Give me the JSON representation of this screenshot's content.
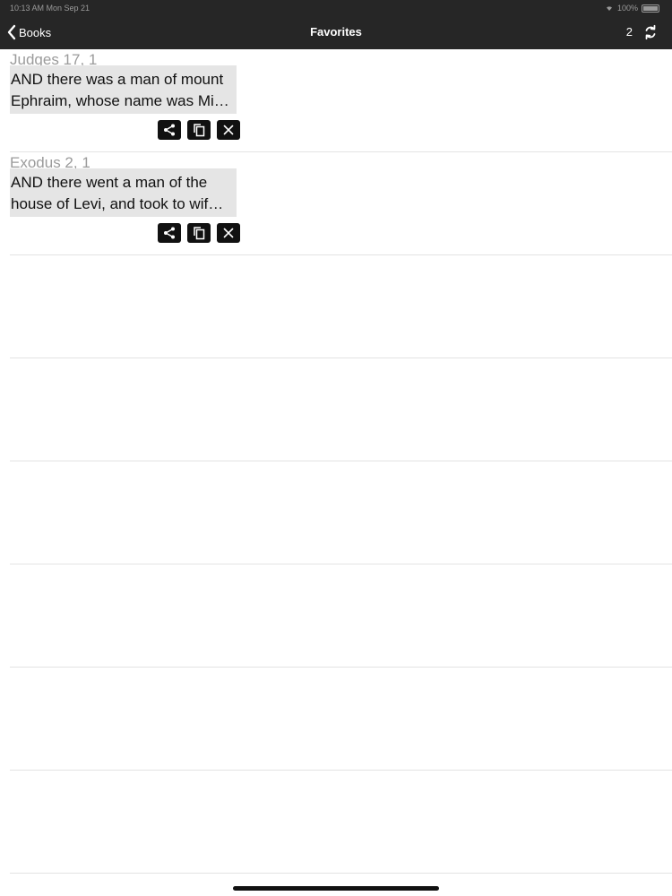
{
  "status_bar": {
    "time": "10:13 AM  Mon Sep 21",
    "battery": "100%"
  },
  "nav": {
    "back_label": "Books",
    "title": "Favorites",
    "count": "2"
  },
  "favorites": [
    {
      "reference": "Judges 17, 1",
      "line1": "AND there was a man of mount",
      "line2": "Ephraim, whose name was Mi…"
    },
    {
      "reference": "Exodus 2, 1",
      "line1": "AND there went a man of the",
      "line2": "house of Levi, and took to wif…"
    }
  ],
  "icons": {
    "back": "chevron-left-icon",
    "refresh": "refresh-icon",
    "share": "share-icon",
    "copy": "copy-icon",
    "delete": "close-icon"
  }
}
